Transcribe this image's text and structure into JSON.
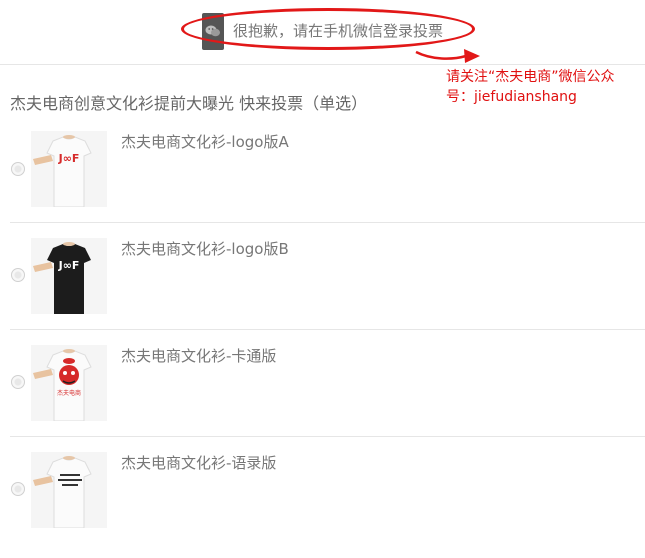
{
  "notice": {
    "text": "很抱歉，请在手机微信登录投票",
    "icon": "wechat-icon"
  },
  "annotation": {
    "line1": "请关注“杰夫电商”微信公众",
    "line2": "号：jiefudianshang",
    "color": "#e01010"
  },
  "vote": {
    "title": "杰夫电商创意文化衫提前大曝光 快来投票（单选）",
    "options": [
      {
        "label": "杰夫电商文化衫-logo版A",
        "shirt_color": "#f4f4f4",
        "print": "JEOF",
        "print_color": "#d62a2a"
      },
      {
        "label": "杰夫电商文化衫-logo版B",
        "shirt_color": "#1c1c1c",
        "print": "JEOF",
        "print_color": "#ffffff"
      },
      {
        "label": "杰夫电商文化衫-卡通版",
        "shirt_color": "#f4f4f4",
        "print": "杰夫电商",
        "print_color": "#d62a2a"
      },
      {
        "label": "杰夫电商文化衫-语录版",
        "shirt_color": "#f4f4f4",
        "print": "",
        "print_color": "#222222"
      }
    ]
  },
  "colors": {
    "accent_red": "#e21818",
    "divider": "#e6e6e6",
    "text_gray": "#666666"
  }
}
